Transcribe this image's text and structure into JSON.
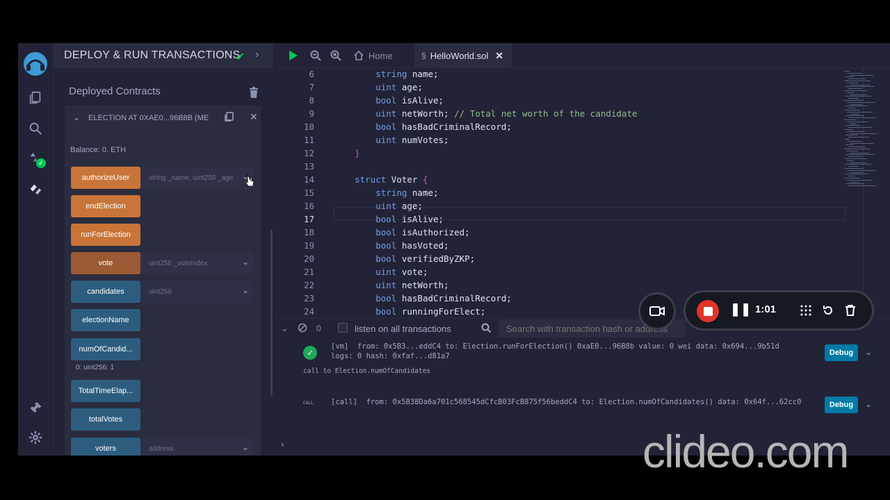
{
  "panel": {
    "title": "DEPLOY & RUN TRANSACTIONS",
    "deployed_title": "Deployed Contracts",
    "contract_name": "ELECTION AT 0XAE0...96B8B (ME",
    "balance": "Balance: 0. ETH",
    "functions": [
      {
        "label": "authorizeUser",
        "input": "string _name, uint256 _age",
        "style": "orange"
      },
      {
        "label": "endElection",
        "input": "",
        "style": "orange"
      },
      {
        "label": "runForElection",
        "input": "",
        "style": "orange"
      },
      {
        "label": "vote",
        "input": "uint256 _voteIndex",
        "style": "orange-dark"
      },
      {
        "label": "candidates",
        "input": "uint256",
        "style": "blue"
      },
      {
        "label": "electionName",
        "input": "",
        "style": "blue"
      },
      {
        "label": "numOfCandid...",
        "input": "",
        "style": "blue"
      },
      {
        "label": "TotalTimeElap...",
        "input": "",
        "style": "blue"
      },
      {
        "label": "totalVotes",
        "input": "",
        "style": "blue"
      },
      {
        "label": "voters",
        "input": "address",
        "style": "blue"
      }
    ],
    "call_result": "0: uint256: 1"
  },
  "tabs": {
    "home": "Home",
    "file": "HelloWorld.sol"
  },
  "editor": {
    "lines": [
      {
        "n": "6",
        "text": "        string name;"
      },
      {
        "n": "7",
        "text": "        uint age;"
      },
      {
        "n": "8",
        "text": "        bool isAlive;"
      },
      {
        "n": "9",
        "text": "        uint netWorth; // Total net worth of the candidate"
      },
      {
        "n": "10",
        "text": "        bool hasBadCriminalRecord;"
      },
      {
        "n": "11",
        "text": "        uint numVotes;"
      },
      {
        "n": "12",
        "text": "    }"
      },
      {
        "n": "13",
        "text": ""
      },
      {
        "n": "14",
        "text": "    struct Voter {"
      },
      {
        "n": "15",
        "text": "        string name;"
      },
      {
        "n": "16",
        "text": "        uint age;"
      },
      {
        "n": "17",
        "text": "        bool isAlive;"
      },
      {
        "n": "18",
        "text": "        bool isAuthorized;"
      },
      {
        "n": "19",
        "text": "        bool hasVoted;"
      },
      {
        "n": "20",
        "text": "        bool verifiedByZKP;"
      },
      {
        "n": "21",
        "text": "        uint vote;"
      },
      {
        "n": "22",
        "text": "        uint netWorth;"
      },
      {
        "n": "23",
        "text": "        bool hasBadCriminalRecord;"
      },
      {
        "n": "24",
        "text": "        bool runningForElect;"
      }
    ]
  },
  "terminal": {
    "count": "0",
    "listen_label": "listen on all transactions",
    "search_placeholder": "Search with transaction hash or address",
    "log1_line1": "[vm]  from: 0x5B3...eddC4 to: Election.runForElection() 0xaE0...96B8b value: 0 wei data: 0x694...9b51d",
    "log1_line2": "logs: 0 hash: 0xfaf...d81a7",
    "log2": "call to Election.numOfCandidates",
    "call_tag": "CALL",
    "log3": "[call]  from: 0x5B38Da6a701c568545dCfcB03FcB875f56beddC4 to: Election.numOfCandidates() data: 0x64f...62cc0",
    "debug_label": "Debug"
  },
  "recorder": {
    "time": "1:01"
  },
  "watermark": "clideo.com"
}
